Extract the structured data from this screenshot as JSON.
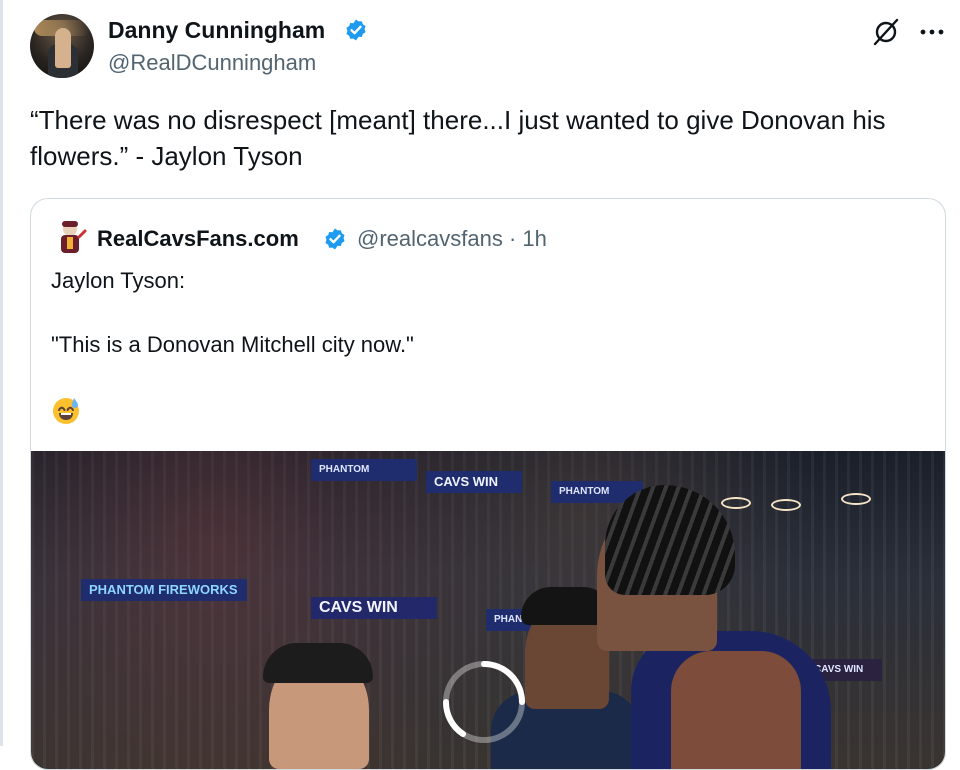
{
  "author": {
    "display_name": "Danny Cunningham",
    "handle": "@RealDCunningham"
  },
  "tweet": {
    "text": "“There was no disrespect [meant] there...I just wanted to give Donovan his flowers.” - Jaylon Tyson"
  },
  "icons": {
    "verified": "verified-badge-icon",
    "grok": "grok-icon",
    "more": "more-icon",
    "emoji": "sweat-smile-emoji-icon"
  },
  "quote": {
    "display_name": "RealCavsFans.com",
    "handle_time": "@realcavsfans · 1h",
    "lines": [
      "Jaylon Tyson:",
      "\"This is a Donovan Mitchell city now.\""
    ],
    "emoji": "😅"
  },
  "media": {
    "banners": [
      "PHANTOM",
      "CAVS WIN",
      "PHANTOM",
      "PHANTOM FIREWORKS",
      "CAVS WIN",
      "PHANTOM",
      "CAVS WIN"
    ]
  },
  "colors": {
    "verified_blue": "#1d9bf0",
    "handle_gray": "#536471",
    "text": "#0f1419",
    "border": "#cfd9de"
  }
}
